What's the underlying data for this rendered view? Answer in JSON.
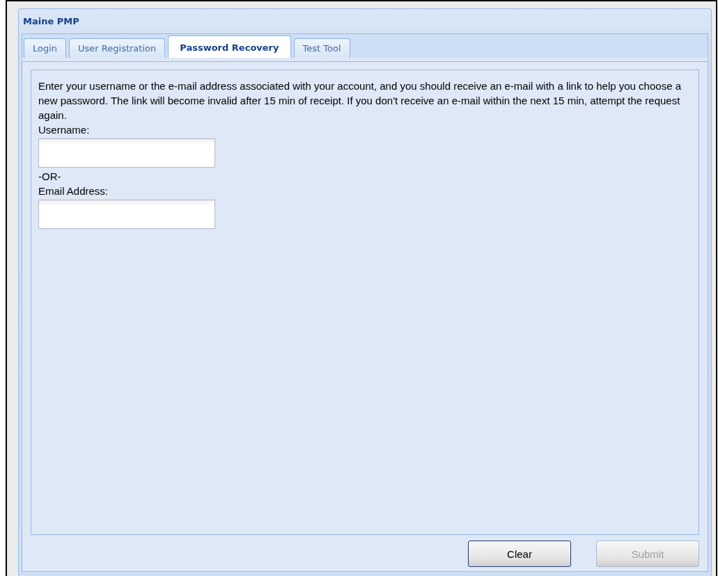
{
  "window": {
    "title": "Maine PMP"
  },
  "tabs": [
    {
      "label": "Login",
      "selected": false
    },
    {
      "label": "User Registration",
      "selected": false
    },
    {
      "label": "Password Recovery",
      "selected": true
    },
    {
      "label": "Test Tool",
      "selected": false
    }
  ],
  "instructions": "Enter your username or the e-mail address associated with your account, and you should receive an e-mail with a link to help you choose a new password. The link will become invalid after 15 min of receipt. If you don't receive an e-mail within the next 15 min, attempt the request again.",
  "form": [
    {
      "kind": "field",
      "label": "Username:"
    },
    {
      "kind": "separator",
      "label": "-OR-"
    },
    {
      "kind": "field",
      "label": "Email Address:"
    }
  ],
  "buttons": [
    {
      "label": "Clear",
      "disabled": false
    },
    {
      "label": "Submit",
      "disabled": true
    }
  ]
}
